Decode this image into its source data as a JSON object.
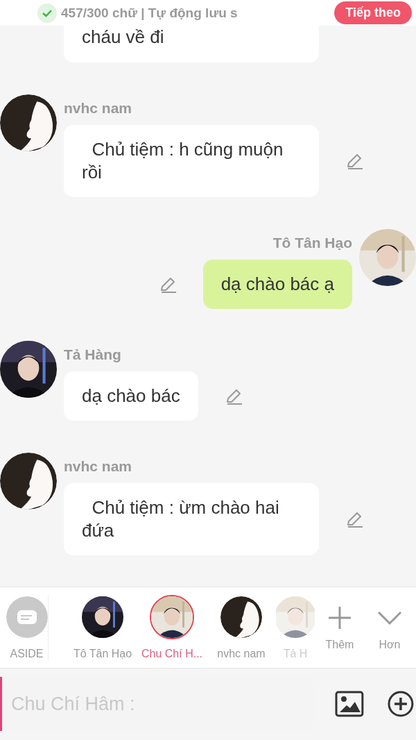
{
  "header": {
    "word_count": "457/300 chữ | Tự động lưu s",
    "next_button": "Tiếp theo"
  },
  "messages": [
    {
      "kind": "continued",
      "text": "cháu về đi"
    },
    {
      "kind": "incoming",
      "name": "nvhc nam",
      "avatar": {
        "kind": "silhouette"
      },
      "text": "  Chủ tiệm : h cũng muộn rồi"
    },
    {
      "kind": "outgoing",
      "name": "Tô Tân Hạo",
      "text": "dạ chào bác ạ"
    },
    {
      "kind": "incoming",
      "name": "Tả Hàng",
      "text": "dạ chào bác"
    },
    {
      "kind": "incoming",
      "name": "nvhc nam",
      "avatar": {
        "kind": "silhouette"
      },
      "text": "  Chủ tiệm : ừm chào hai đứa"
    }
  ],
  "characters": [
    {
      "label": "ASIDE",
      "avatar": {
        "kind": "aside"
      },
      "selected": false
    },
    {
      "label": "Tô Tân Hạo",
      "selected": false
    },
    {
      "label": "Chu Chí H...",
      "selected": true
    },
    {
      "label": "nvhc nam",
      "avatar": {
        "kind": "silhouette"
      },
      "selected": false
    },
    {
      "label": "Tả H",
      "selected": false,
      "faded": true
    }
  ],
  "strip_actions": [
    "Thêm",
    "Hơn"
  ],
  "input": {
    "placeholder": "Chu Chí Hâm :"
  }
}
